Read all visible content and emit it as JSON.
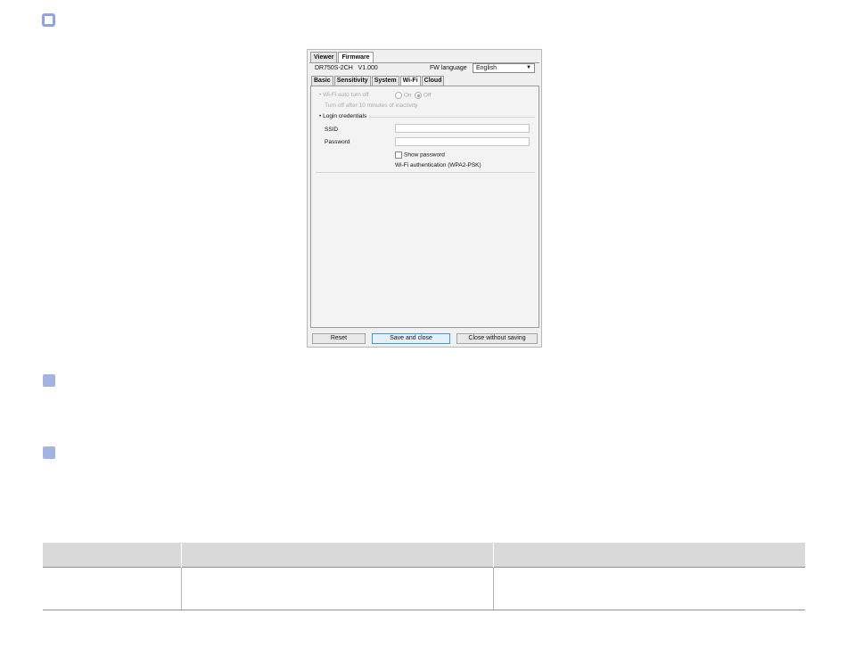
{
  "dialog": {
    "top_tabs": [
      "Viewer",
      "Firmware"
    ],
    "model": "DR750S-2CH",
    "version": "V1.000",
    "fw_language_label": "FW language",
    "fw_language_value": "English",
    "sub_tabs": [
      "Basic",
      "Sensitivity",
      "System",
      "Wi-Fi",
      "Cloud"
    ],
    "active_sub_tab": "Wi-Fi",
    "wifi_auto_turn_off": {
      "label": "Wi-Fi auto turn off",
      "options": [
        "On",
        "Off"
      ],
      "selected": "Off",
      "hint": "Turn off after 10 minutes of inactivity"
    },
    "login_credentials": {
      "label": "Login credentials",
      "ssid_label": "SSID",
      "ssid_value": "",
      "password_label": "Password",
      "password_value": "",
      "show_password_label": "Show password",
      "auth_text": "Wi-Fi authentication (WPA2-PSK)"
    },
    "buttons": {
      "reset": "Reset",
      "save": "Save and close",
      "close": "Close without saving"
    }
  },
  "table": {
    "headers": [
      "",
      "",
      ""
    ],
    "rows": [
      [
        "",
        "",
        ""
      ]
    ]
  }
}
